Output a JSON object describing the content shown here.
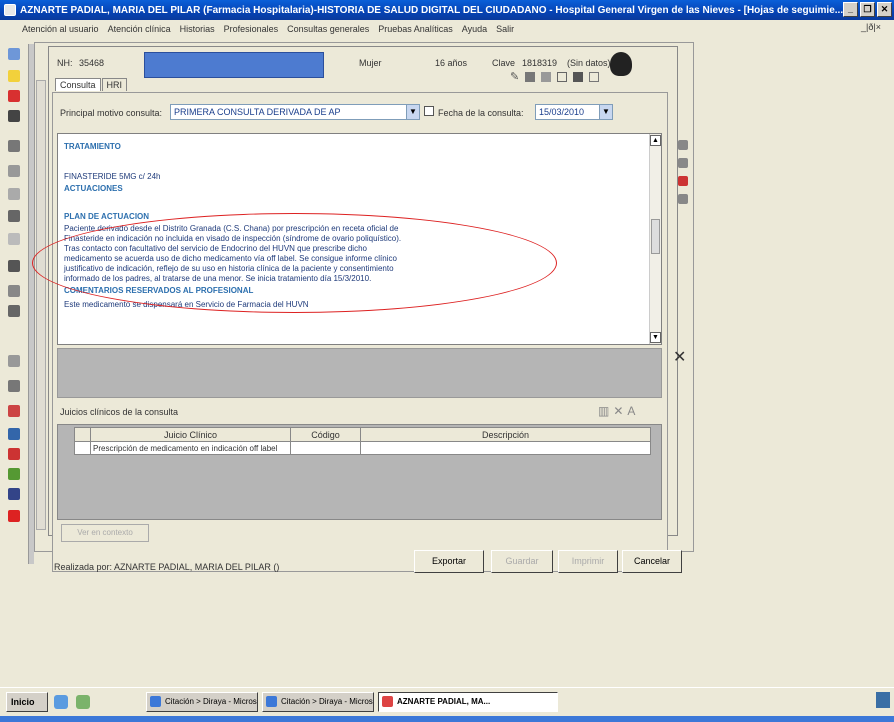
{
  "window": {
    "title": "AZNARTE PADIAL, MARIA DEL PILAR (Farmacia Hospitalaria)-HISTORIA DE SALUD DIGITAL DEL CIUDADANO - Hospital General Virgen de las Nieves - [Hojas de seguimie...",
    "minimize": "_",
    "restore": "❐",
    "close": "✕"
  },
  "menubar": {
    "items": [
      "Atención al usuario",
      "Atención clínica",
      "Historias",
      "Profesionales",
      "Consultas generales",
      "Pruebas Analíticas",
      "Ayuda",
      "Salir"
    ],
    "right_controls": "_|ð|×"
  },
  "header": {
    "nh_label": "NH:",
    "nh_value": "35468",
    "sex": "Mujer",
    "age": "16 años",
    "clave_label": "Clave",
    "clave_value": "1818319",
    "status": "(Sin datos)"
  },
  "tabs": [
    {
      "label": "Consulta"
    },
    {
      "label": "HRI"
    }
  ],
  "form": {
    "motivo_label": "Principal motivo consulta:",
    "motivo_value": "PRIMERA CONSULTA DERIVADA DE AP",
    "fecha_label": "Fecha de la consulta:",
    "fecha_value": "15/03/2010"
  },
  "notes": {
    "tratamiento_title": "TRATAMIENTO",
    "tratamiento_text": "FINASTERIDE 5MG c/ 24h",
    "actuaciones_title": "ACTUACIONES",
    "plan_title": "PLAN DE ACTUACION",
    "plan_lines": [
      "Paciente derivado desde el Distrito Granada (C.S. Chana) por prescripción en receta oficial de",
      "Finasteride en indicación no incluida en visado de inspección (síndrome de ovario poliquístico).",
      "Tras contacto con facultativo del servicio de Endocrino del HUVN que prescribe dicho",
      "medicamento se acuerda uso de dicho medicamento  vía off label. Se consigue informe clínico",
      "justificativo de indicación, reflejo de su uso en historia clínica de la paciente y consentimiento",
      "informado de los padres, al tratarse de una menor. Se inicia tratamiento día 15/3/2010."
    ],
    "comentarios_title": "COMENTARIOS RESERVADOS AL PROFESIONAL",
    "comentarios_text": "Este medicamento se dispensará en Servicio de Farmacia del HUVN"
  },
  "juicios": {
    "label": "Juicios clínicos de la consulta",
    "columns": [
      "Juicio Clínico",
      "Código",
      "Descripción"
    ],
    "rows": [
      {
        "juicio": "Prescripción de medicamento en indicación off label",
        "codigo": "",
        "descripcion": ""
      }
    ]
  },
  "buttons": {
    "small": "Ver en contexto",
    "exportar": "Exportar",
    "guardar": "Guardar",
    "imprimir": "Imprimir",
    "cancelar": "Cancelar"
  },
  "footer": {
    "realizada": "Realizada por: AZNARTE PADIAL, MARIA DEL PILAR ()"
  },
  "taskbar": {
    "start": "Inicio",
    "tasks": [
      {
        "label": "Citación > Diraya - Micros..."
      },
      {
        "label": "Citación > Diraya - Micros..."
      },
      {
        "label": "AZNARTE PADIAL, MA..."
      }
    ]
  },
  "colors": {
    "titlebar": "#0543b5",
    "note_text": "#1e3a7a",
    "note_heading": "#2c6fae",
    "highlight_ellipse": "#dd2222",
    "header_bar": "#4d7bd0"
  }
}
